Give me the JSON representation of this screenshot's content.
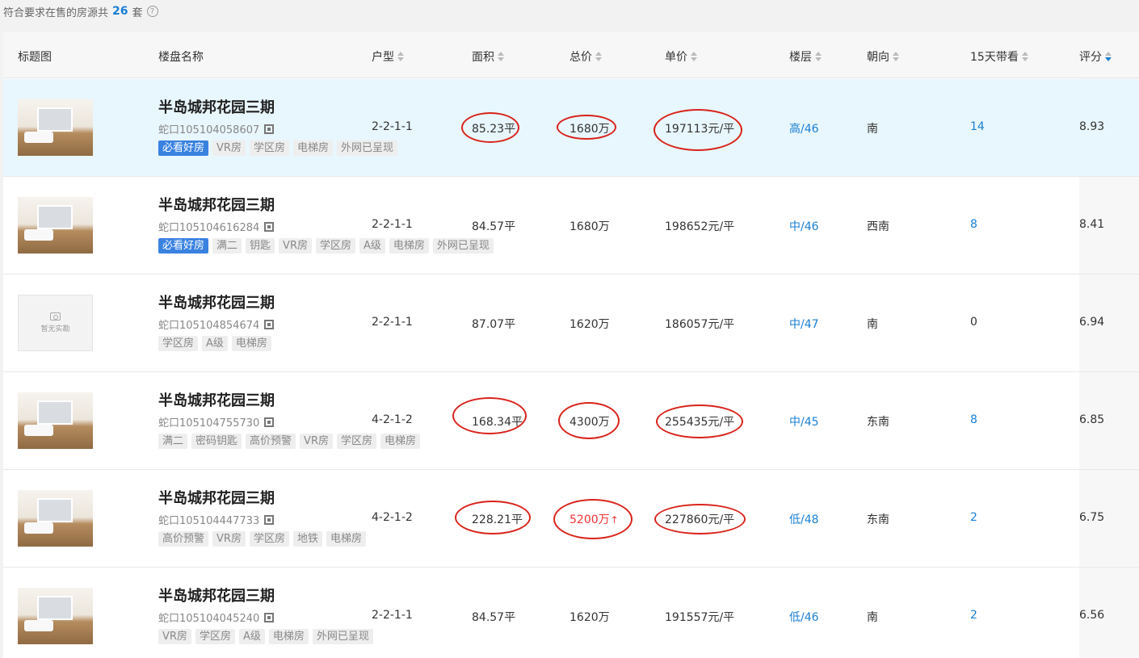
{
  "summary": {
    "prefix": "符合要求在售的房源共",
    "count": "26",
    "suffix": "套",
    "help": "?"
  },
  "headers": {
    "thumb": "标题图",
    "name": "楼盘名称",
    "layout": "户型",
    "area": "面积",
    "total": "总价",
    "unit": "单价",
    "floor": "楼层",
    "facing": "朝向",
    "views": "15天带看",
    "score": "评分"
  },
  "sort": {
    "active_column": "评分",
    "direction": "descending"
  },
  "rows": [
    {
      "highlighted": true,
      "thumb": "photo",
      "name": "半岛城邦花园三期",
      "code": "蛇口105104058607",
      "tags": [
        "必看好房",
        "VR房",
        "学区房",
        "电梯房",
        "外网已呈现"
      ],
      "layout": "2-2-1-1",
      "area": "85.23平",
      "total": "1680万",
      "unit": "197113元/平",
      "floor": "高/46",
      "facing": "南",
      "views": "14",
      "score": "8.93",
      "circled": [
        "area",
        "total",
        "unit"
      ],
      "views_link": true
    },
    {
      "highlighted": false,
      "thumb": "photo",
      "name": "半岛城邦花园三期",
      "code": "蛇口105104616284",
      "tags": [
        "必看好房",
        "满二",
        "钥匙",
        "VR房",
        "学区房",
        "A级",
        "电梯房",
        "外网已呈现"
      ],
      "layout": "2-2-1-1",
      "area": "84.57平",
      "total": "1680万",
      "unit": "198652元/平",
      "floor": "中/46",
      "facing": "西南",
      "views": "8",
      "score": "8.41",
      "circled": [],
      "views_link": true
    },
    {
      "highlighted": false,
      "thumb": "empty",
      "thumb_text": "暂无实勘",
      "name": "半岛城邦花园三期",
      "code": "蛇口105104854674",
      "tags": [
        "学区房",
        "A级",
        "电梯房"
      ],
      "layout": "2-2-1-1",
      "area": "87.07平",
      "total": "1620万",
      "unit": "186057元/平",
      "floor": "中/47",
      "facing": "南",
      "views": "0",
      "score": "6.94",
      "circled": [],
      "views_link": false
    },
    {
      "highlighted": false,
      "thumb": "photo",
      "name": "半岛城邦花园三期",
      "code": "蛇口105104755730",
      "tags": [
        "满二",
        "密码钥匙",
        "高价预警",
        "VR房",
        "学区房",
        "电梯房"
      ],
      "layout": "4-2-1-2",
      "area": "168.34平",
      "total": "4300万",
      "unit": "255435元/平",
      "floor": "中/45",
      "facing": "东南",
      "views": "8",
      "score": "6.85",
      "circled": [
        "area",
        "total",
        "unit"
      ],
      "views_link": true
    },
    {
      "highlighted": false,
      "thumb": "photo",
      "name": "半岛城邦花园三期",
      "code": "蛇口105104447733",
      "tags": [
        "高价预警",
        "VR房",
        "学区房",
        "地铁",
        "电梯房"
      ],
      "layout": "4-2-1-2",
      "area": "228.21平",
      "total": "5200万",
      "total_flag": "↑",
      "unit": "227860元/平",
      "floor": "低/48",
      "facing": "东南",
      "views": "2",
      "score": "6.75",
      "circled": [
        "area",
        "total",
        "unit"
      ],
      "views_link": true
    },
    {
      "highlighted": false,
      "thumb": "photo",
      "name": "半岛城邦花园三期",
      "code": "蛇口105104045240",
      "tags": [
        "VR房",
        "学区房",
        "A级",
        "电梯房",
        "外网已呈现"
      ],
      "layout": "2-2-1-1",
      "area": "84.57平",
      "total": "1620万",
      "unit": "191557元/平",
      "floor": "低/46",
      "facing": "南",
      "views": "2",
      "score": "6.56",
      "circled": [],
      "views_link": true
    }
  ],
  "colors": {
    "link": "#1a7fd4",
    "highlight_row": "#e8f6fd",
    "tag_primary": "#3a82e0",
    "annotation": "#d9231b",
    "price_up": "#e33"
  },
  "icons": {
    "qr": "qr-code-icon",
    "help": "help-icon",
    "camera": "camera-icon",
    "sort": "sort-icon"
  }
}
